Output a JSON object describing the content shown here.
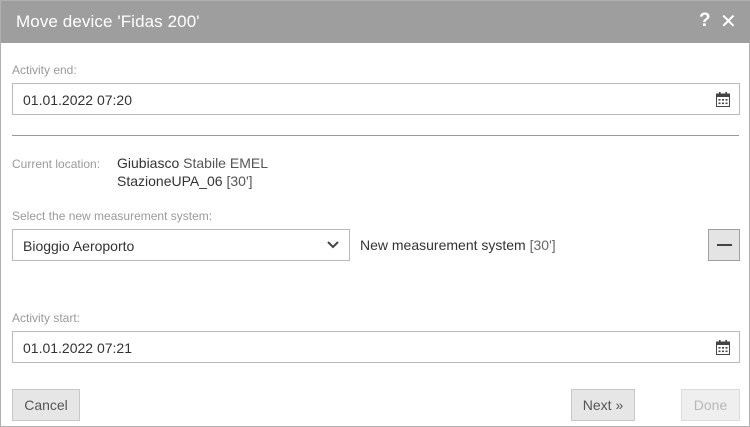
{
  "dialog": {
    "title_prefix": "Move device '",
    "device_name": "Fidas 200",
    "title_suffix": "'",
    "help_glyph": "?",
    "close_glyph": "✕"
  },
  "activity_end": {
    "label": "Activity end:",
    "value": "01.01.2022 07:20"
  },
  "current_location": {
    "label": "Current location:",
    "place": "Giubiasco",
    "building": "Stabile EMEL",
    "station": "StazioneUPA_06",
    "interval": "[30']"
  },
  "measurement_system": {
    "label": "Select the new measurement system:",
    "selected": "Bioggio Aeroporto",
    "new_label": "New measurement system",
    "new_interval": "[30']"
  },
  "activity_start": {
    "label": "Activity start:",
    "value": "01.01.2022 07:21"
  },
  "buttons": {
    "cancel": "Cancel",
    "next": "Next »",
    "done": "Done"
  },
  "icons": [
    "help-icon",
    "close-icon",
    "calendar-icon",
    "chevron-down-icon",
    "minus-icon"
  ],
  "colors": {
    "titlebar": "#9e9e9e",
    "label_gray": "#9a9a9a",
    "border": "#b9b9b9"
  }
}
